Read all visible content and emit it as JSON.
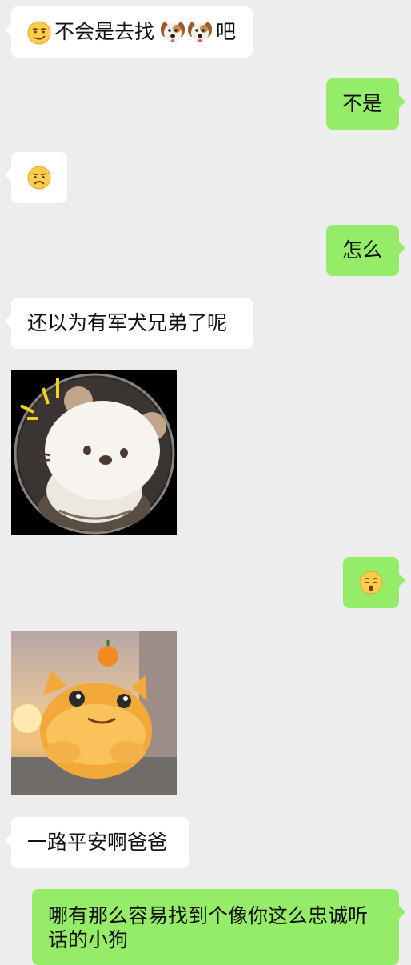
{
  "messages": [
    {
      "side": "left",
      "text_before": "不会是去找",
      "text_after": "吧",
      "emojis": [
        "smirk-face-icon",
        "dog-face-icon",
        "dog-face-icon"
      ]
    },
    {
      "side": "right",
      "text": "不是"
    },
    {
      "side": "left",
      "emojis": [
        "frowning-face-icon"
      ]
    },
    {
      "side": "right",
      "text": "怎么"
    },
    {
      "side": "left",
      "text": "还以为有军犬兄弟了呢"
    },
    {
      "side": "left",
      "sticker": "white-plush-bear-sticker"
    },
    {
      "side": "right",
      "emojis": [
        "kissing-face-icon"
      ]
    },
    {
      "side": "left",
      "sticker": "orange-plush-creature-sticker"
    },
    {
      "side": "left",
      "text": "一路平安啊爸爸"
    },
    {
      "side": "right",
      "lines": [
        "哪有那么容易找到个像你这么忠诚听",
        "话的小狗"
      ]
    }
  ],
  "colors": {
    "background": "#ededed",
    "received_bubble": "#ffffff",
    "sent_bubble": "#95ec69",
    "text": "#111111"
  }
}
